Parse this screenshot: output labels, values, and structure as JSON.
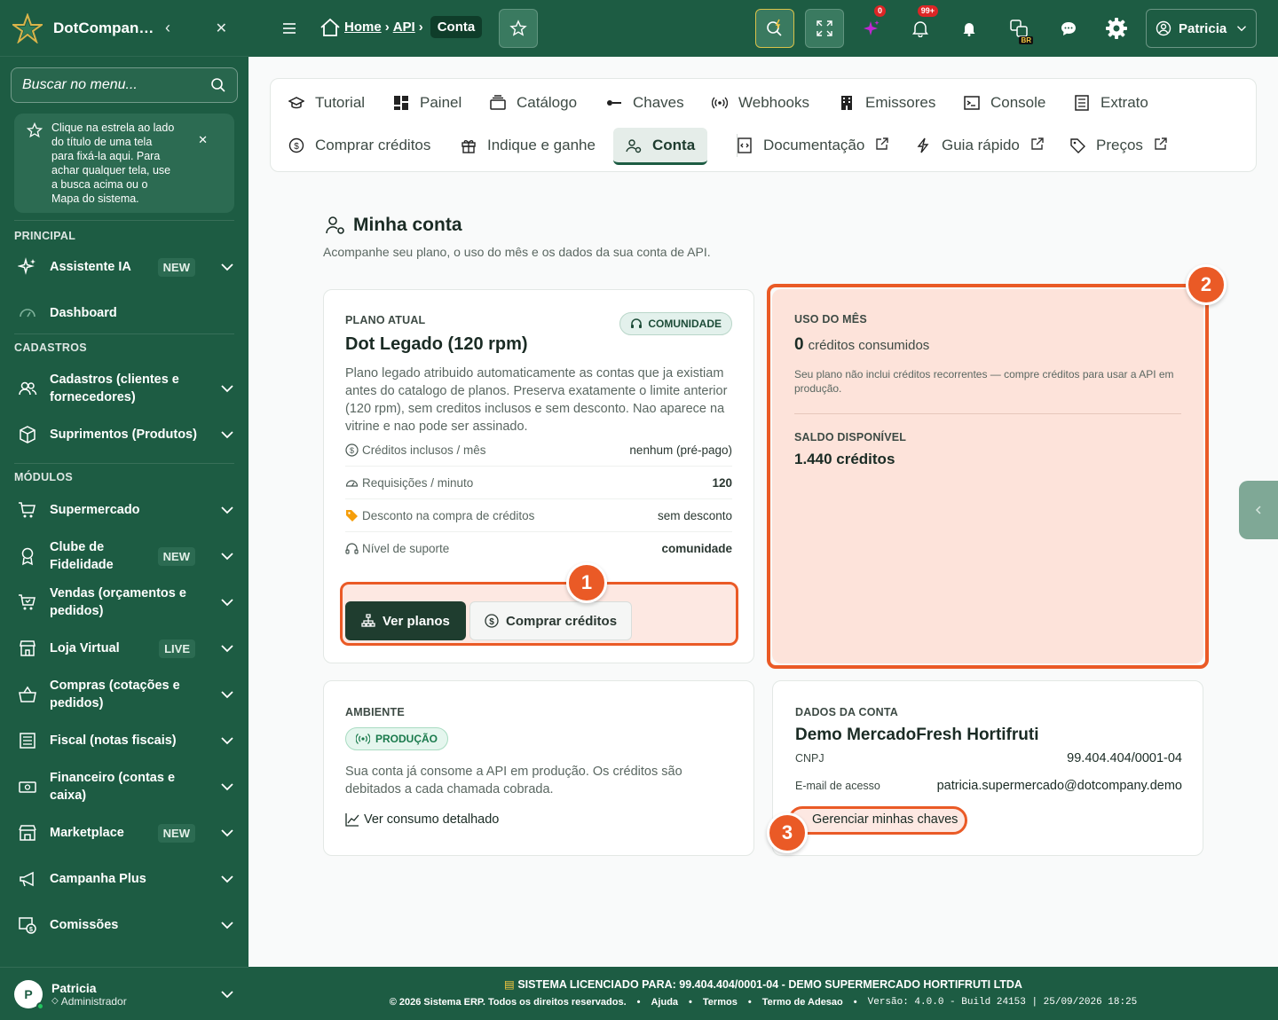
{
  "sidebar": {
    "brand": "DotCompan…",
    "search_placeholder": "Buscar no menu...",
    "tip": "Clique na estrela ao lado do título de uma tela para fixá-la aqui. Para achar qualquer tela, use a busca acima ou o Mapa do sistema.",
    "sections": {
      "principal": "PRINCIPAL",
      "cadastros": "CADASTROS",
      "modulos": "MÓDULOS"
    },
    "items": [
      {
        "label": "Assistente IA",
        "badge": "NEW"
      },
      {
        "label": "Dashboard",
        "badge": ""
      },
      {
        "label": "Cadastros (clientes e fornecedores)",
        "badge": ""
      },
      {
        "label": "Suprimentos (Produtos)",
        "badge": ""
      },
      {
        "label": "Supermercado",
        "badge": ""
      },
      {
        "label": "Clube de Fidelidade",
        "badge": "NEW"
      },
      {
        "label": "Vendas (orçamentos e pedidos)",
        "badge": ""
      },
      {
        "label": "Loja Virtual",
        "badge": "LIVE"
      },
      {
        "label": "Compras (cotações e pedidos)",
        "badge": ""
      },
      {
        "label": "Fiscal (notas fiscais)",
        "badge": ""
      },
      {
        "label": "Financeiro (contas e caixa)",
        "badge": ""
      },
      {
        "label": "Marketplace",
        "badge": "NEW"
      },
      {
        "label": "Campanha Plus",
        "badge": ""
      },
      {
        "label": "Comissões",
        "badge": ""
      }
    ],
    "user": {
      "initial": "P",
      "name": "Patricia",
      "role": "Administrador"
    }
  },
  "topbar": {
    "breadcrumb": [
      "Home",
      "API",
      "Conta"
    ],
    "notif_sparkle": "0",
    "notif_bell": "99+",
    "lang": "BR",
    "user": "Patricia"
  },
  "tabs": [
    {
      "label": "Tutorial",
      "icon": "graduation-cap-icon"
    },
    {
      "label": "Painel",
      "icon": "dashboard-icon"
    },
    {
      "label": "Catálogo",
      "icon": "catalog-icon"
    },
    {
      "label": "Chaves",
      "icon": "key-icon"
    },
    {
      "label": "Webhooks",
      "icon": "broadcast-icon"
    },
    {
      "label": "Emissores",
      "icon": "building-icon"
    },
    {
      "label": "Console",
      "icon": "terminal-icon"
    },
    {
      "label": "Extrato",
      "icon": "receipt-icon"
    },
    {
      "label": "Comprar créditos",
      "icon": "coin-icon"
    },
    {
      "label": "Indique e ganhe",
      "icon": "gift-icon"
    },
    {
      "label": "Conta",
      "icon": "user-gear-icon"
    },
    {
      "label": "Documentação",
      "icon": "code-file-icon"
    },
    {
      "label": "Guia rápido",
      "icon": "bolt-icon"
    },
    {
      "label": "Preços",
      "icon": "tag-icon"
    }
  ],
  "page": {
    "title": "Minha conta",
    "subtitle": "Acompanhe seu plano, o uso do mês e os dados da sua conta de API."
  },
  "plan": {
    "caption": "PLANO ATUAL",
    "badge": "COMUNIDADE",
    "name": "Dot Legado (120 rpm)",
    "description": "Plano legado atribuido automaticamente as contas que ja existiam antes do catalogo de planos. Preserva exatamente o limite anterior (120 rpm), sem creditos inclusos e sem desconto. Nao aparece na vitrine e nao pode ser assinado.",
    "rows": [
      {
        "k": "Créditos inclusos / mês",
        "v": "nenhum (pré-pago)"
      },
      {
        "k": "Requisições / minuto",
        "v": "120"
      },
      {
        "k": "Desconto na compra de créditos",
        "v": "sem desconto"
      },
      {
        "k": "Nível de suporte",
        "v": "comunidade"
      }
    ],
    "btn_plans": "Ver planos",
    "btn_buy": "Comprar créditos"
  },
  "usage": {
    "caption": "USO DO MÊS",
    "consumed_value": "0",
    "consumed_label": "créditos consumidos",
    "note": "Seu plano não inclui créditos recorrentes — compre créditos para usar a API em produção.",
    "balance_caption": "SALDO DISPONÍVEL",
    "balance": "1.440 créditos"
  },
  "env": {
    "caption": "AMBIENTE",
    "badge": "PRODUÇÃO",
    "text": "Sua conta já consome a API em produção. Os créditos são debitados a cada chamada cobrada.",
    "link": "Ver consumo detalhado"
  },
  "account": {
    "caption": "DADOS DA CONTA",
    "name": "Demo MercadoFresh Hortifruti",
    "cnpj_label": "CNPJ",
    "cnpj": "99.404.404/0001-04",
    "email_label": "E-mail de acesso",
    "email": "patricia.supermercado@dotcompany.demo",
    "link": "Gerenciar minhas chaves"
  },
  "markers": [
    "1",
    "2",
    "3"
  ],
  "footer": {
    "license_label": "SISTEMA LICENCIADO PARA:",
    "license_value": "99.404.404/0001-04 - DEMO SUPERMERCADO HORTIFRUTI LTDA",
    "copyright": "© 2026 Sistema ERP. Todos os direitos reservados.",
    "links": [
      "Ajuda",
      "Termos",
      "Termo de Adesao"
    ],
    "version": "Versão: 4.0.0 - Build 24153 | 25/09/2026 18:25"
  },
  "colors": {
    "brand": "#1d5c43",
    "highlight": "#ea5a26",
    "highlight_fill": "#fde3da"
  }
}
